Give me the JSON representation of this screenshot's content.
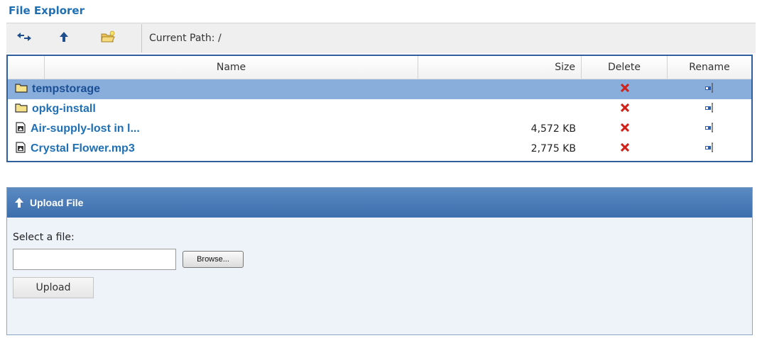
{
  "title": "File Explorer",
  "toolbar": {
    "back_icon": "swap-arrows-icon",
    "up_icon": "up-arrow-icon",
    "new_folder_icon": "new-folder-icon",
    "current_path": "Current Path: /"
  },
  "table": {
    "columns": {
      "name": "Name",
      "size": "Size",
      "delete": "Delete",
      "rename": "Rename"
    },
    "rows": [
      {
        "name": "tempstorage",
        "type": "folder",
        "size": "",
        "selected": true
      },
      {
        "name": "opkg-install",
        "type": "folder",
        "size": "",
        "selected": false
      },
      {
        "name": "Air-supply-lost in l...",
        "type": "file",
        "size": "4,572 KB",
        "selected": false
      },
      {
        "name": "Crystal Flower.mp3",
        "type": "file",
        "size": "2,775 KB",
        "selected": false
      }
    ]
  },
  "upload": {
    "header": "Upload File",
    "select_label": "Select a file:",
    "file_value": "",
    "browse_label": "Browse...",
    "upload_label": "Upload"
  },
  "colors": {
    "accent": "#1f6fb5",
    "selected_row": "#8aaedc",
    "delete": "#d0201a",
    "panel_header": "#4a7cba"
  }
}
